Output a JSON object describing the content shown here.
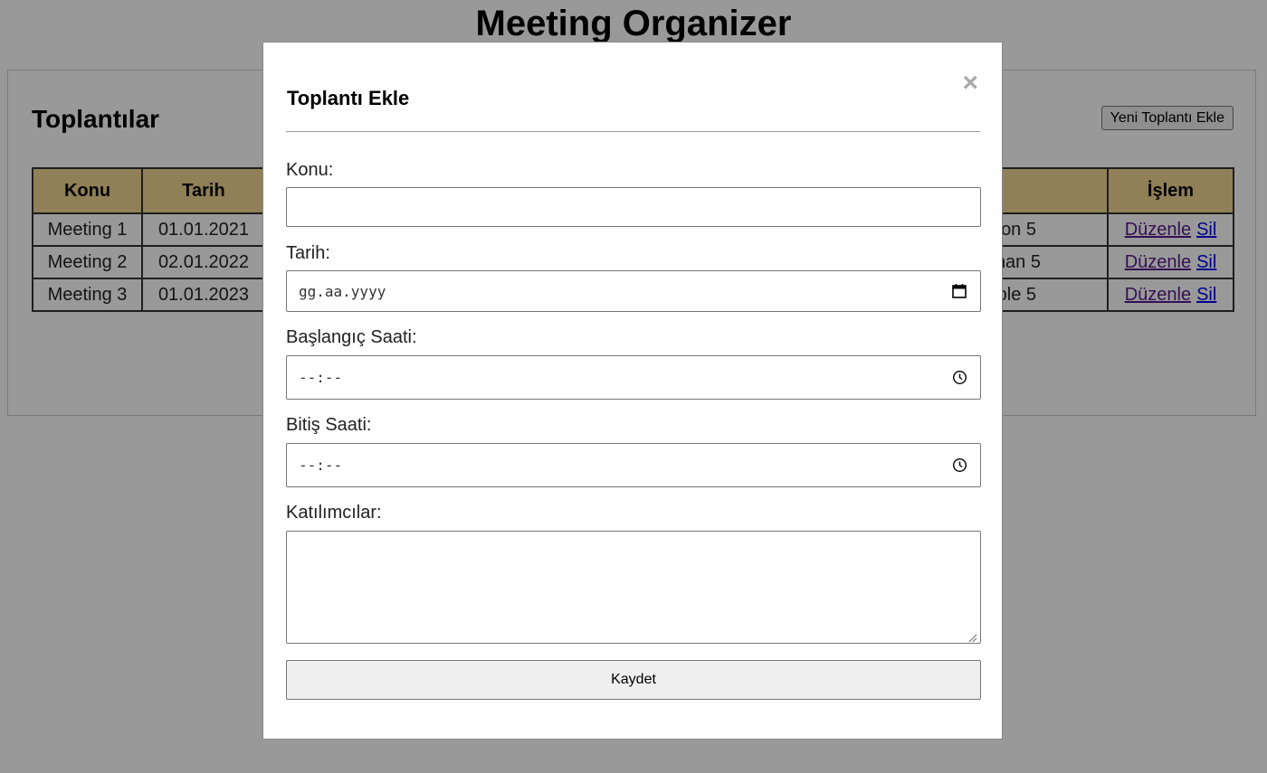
{
  "app": {
    "title": "Meeting Organizer"
  },
  "panel": {
    "title": "Toplantılar",
    "add_button": "Yeni Toplantı Ekle"
  },
  "table": {
    "headers": [
      "Konu",
      "Tarih",
      "",
      "İşlem"
    ],
    "rows": [
      {
        "konu": "Meeting 1",
        "tarih": "01.01.2021",
        "partial": "on 5",
        "edit": "Düzenle",
        "delete": "Sil"
      },
      {
        "konu": "Meeting 2",
        "tarih": "02.01.2022",
        "partial": "nan 5",
        "edit": "Düzenle",
        "delete": "Sil"
      },
      {
        "konu": "Meeting 3",
        "tarih": "01.01.2023",
        "partial": "ple 5",
        "edit": "Düzenle",
        "delete": "Sil"
      }
    ],
    "header_color": "#f1d591"
  },
  "modal": {
    "title": "Toplantı Ekle",
    "close_icon": "close-icon",
    "fields": {
      "konu": {
        "label": "Konu:",
        "value": ""
      },
      "tarih": {
        "label": "Tarih:",
        "placeholder": "gg.aa.yyyy",
        "icon": "calendar-icon"
      },
      "baslangic": {
        "label": "Başlangıç Saati:",
        "placeholder": "--:--",
        "icon": "clock-icon"
      },
      "bitis": {
        "label": "Bitiş Saati:",
        "placeholder": "--:--",
        "icon": "clock-icon"
      },
      "katilimcilar": {
        "label": "Katılımcılar:",
        "value": ""
      }
    },
    "save_button": "Kaydet"
  }
}
